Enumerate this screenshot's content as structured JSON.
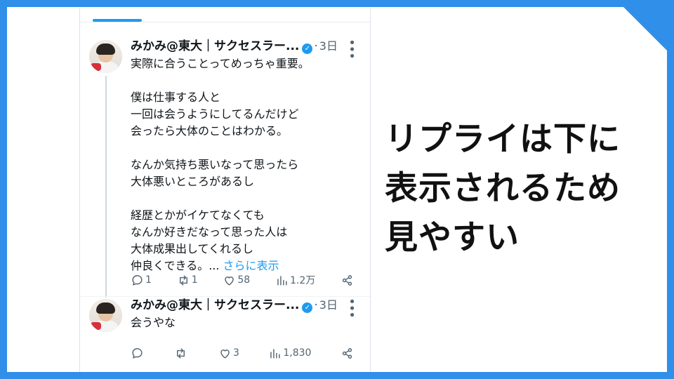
{
  "colors": {
    "frame": "#2f8fe9",
    "accent": "#1d9bf0",
    "text": "#0f1419",
    "muted": "#536471"
  },
  "tweets": [
    {
      "author": "みかみ@東大｜サクセスラー...",
      "verified_icon": "verified-badge-icon",
      "separator": "·",
      "time": "3日",
      "paragraphs": [
        [
          "実際に合うことってめっちゃ重要。"
        ],
        [
          "僕は仕事する人と",
          "一回は会うようにしてるんだけど",
          "会ったら大体のことはわかる。"
        ],
        [
          "なんか気持ち悪いなって思ったら",
          "大体悪いところがあるし"
        ],
        [
          "経歴とかがイケてなくても",
          "なんか好きだなって思った人は",
          "大体成果出してくれるし"
        ]
      ],
      "last_line": "仲良くできる。... ",
      "show_more": "さらに表示",
      "replies": "1",
      "reposts": "1",
      "likes": "58",
      "views": "1.2万"
    },
    {
      "author": "みかみ@東大｜サクセスラー...",
      "verified_icon": "verified-badge-icon",
      "separator": "·",
      "time": "3日",
      "text": "会うやな",
      "replies": "",
      "reposts": "",
      "likes": "3",
      "views": "1,830"
    }
  ],
  "headline": {
    "line1": "リプライは下に",
    "line2": "表示されるため",
    "line3": "見やすい"
  }
}
